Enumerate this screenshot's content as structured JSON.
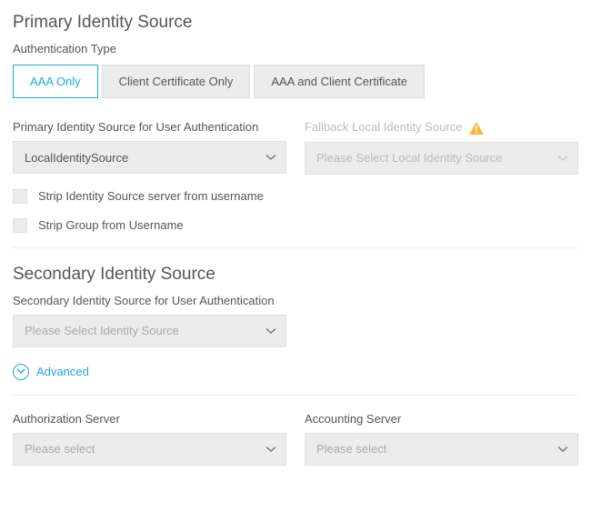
{
  "primary": {
    "title": "Primary Identity Source",
    "auth_type_label": "Authentication Type",
    "tabs": {
      "aaa_only": "AAA Only",
      "cert_only": "Client Certificate Only",
      "aaa_and_cert": "AAA and Client Certificate"
    },
    "source_label": "Primary Identity Source for User Authentication",
    "source_value": "LocalIdentitySource",
    "fallback_label": "Fallback Local Identity Source",
    "fallback_placeholder": "Please Select Local Identity Source",
    "strip_server_label": "Strip Identity Source server from username",
    "strip_group_label": "Strip Group from Username"
  },
  "secondary": {
    "title": "Secondary Identity Source",
    "source_label": "Secondary Identity Source for User Authentication",
    "source_placeholder": "Please Select Identity Source",
    "advanced_label": "Advanced"
  },
  "servers": {
    "authz_label": "Authorization Server",
    "authz_placeholder": "Please select",
    "acct_label": "Accounting Server",
    "acct_placeholder": "Please select"
  },
  "colors": {
    "accent": "#1fa7e0",
    "warning": "#f5b82e"
  }
}
